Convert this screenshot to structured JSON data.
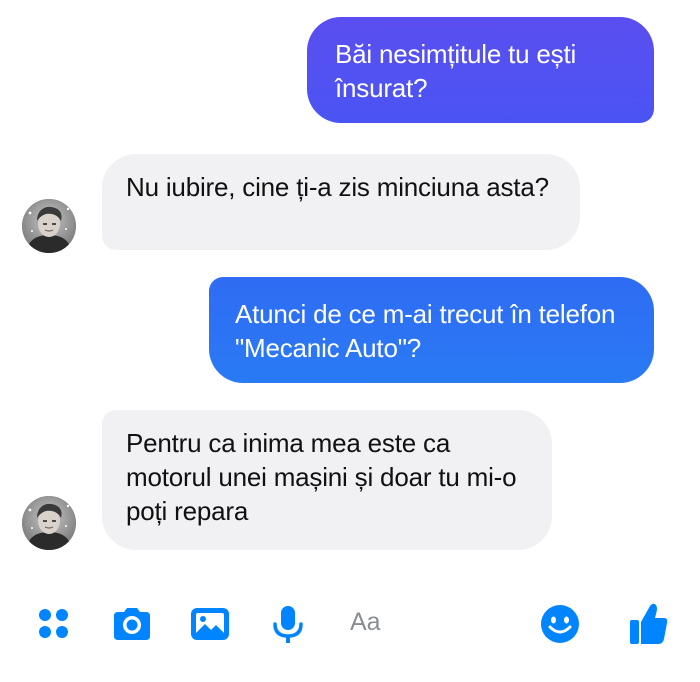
{
  "conversation": {
    "messages": [
      {
        "from": "me",
        "text": "Băi nesimțitule tu ești însurat?"
      },
      {
        "from": "contact",
        "text": "Nu iubire, cine ți-a zis minciuna asta?"
      },
      {
        "from": "me",
        "text": "Atunci de ce m-ai trecut în telefon \"Mecanic Auto\"?"
      },
      {
        "from": "contact",
        "text": "Pentru ca inima mea este ca motorul unei mașini și doar tu mi-o poți repara"
      }
    ]
  },
  "composer": {
    "placeholder": "Aa",
    "icons": [
      "apps-icon",
      "camera-icon",
      "image-icon",
      "microphone-icon",
      "emoji-icon",
      "thumbs-up-icon"
    ]
  },
  "colors": {
    "accent": "#0084ff",
    "sent_bubble_top": "#5b4ef0",
    "sent_bubble_bottom": "#2a7af4",
    "received_bubble": "#f1f1f3"
  }
}
